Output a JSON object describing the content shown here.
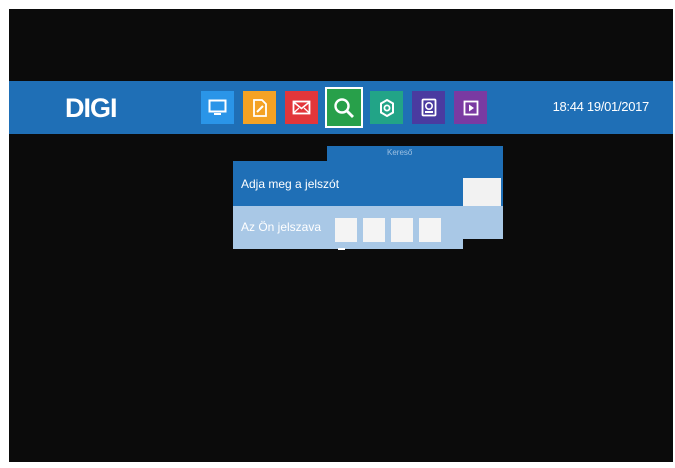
{
  "header": {
    "brand": "DIGI",
    "time": "18:44",
    "date": "19/01/2017",
    "menu_icons": [
      {
        "name": "tv-icon",
        "color": "#2a95e8"
      },
      {
        "name": "notes-icon",
        "color": "#f4a224"
      },
      {
        "name": "mail-icon",
        "color": "#e2363a"
      },
      {
        "name": "search-icon",
        "color": "#28a04a",
        "selected": true
      },
      {
        "name": "settings-icon",
        "color": "#22a487"
      },
      {
        "name": "storage-icon",
        "color": "#4a3ba0"
      },
      {
        "name": "media-player-icon",
        "color": "#7a3aa2"
      }
    ]
  },
  "password_dialog": {
    "title": "Kereső",
    "prompt_label": "Adja meg a jelszót",
    "password_label": "Az Ön jelszava",
    "digit_count": 4
  },
  "colors": {
    "bar_blue": "#1f6fb6",
    "light_blue": "#a9c8e6",
    "background": "#0b0b0b"
  }
}
